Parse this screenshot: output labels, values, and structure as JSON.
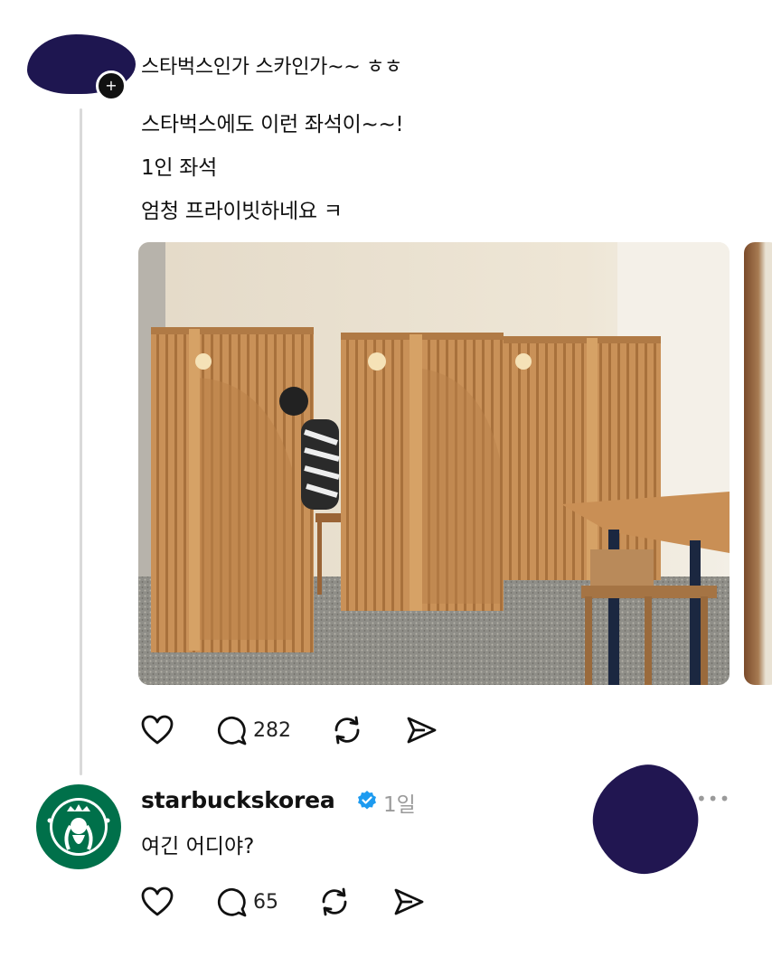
{
  "post": {
    "title": "스타벅스인가 스카인가~~ ㅎㅎ",
    "lines": [
      "스타벅스에도 이런 좌석이~~!",
      "1인 좌석",
      "엄청 프라이빗하네요 ㅋ"
    ],
    "reply_count": "282"
  },
  "reply": {
    "username": "starbuckskorea",
    "time": "1일",
    "text": "여긴 어디야?",
    "reply_count": "65"
  },
  "icons": {
    "like": "heart-icon",
    "reply": "comment-icon",
    "repost": "repost-icon",
    "share": "share-icon",
    "verified": "verified-badge-icon",
    "more": "more-icon"
  },
  "colors": {
    "verified": "#1d9bf0",
    "starbucks_green": "#00704a",
    "muted": "#9a9a9a"
  }
}
